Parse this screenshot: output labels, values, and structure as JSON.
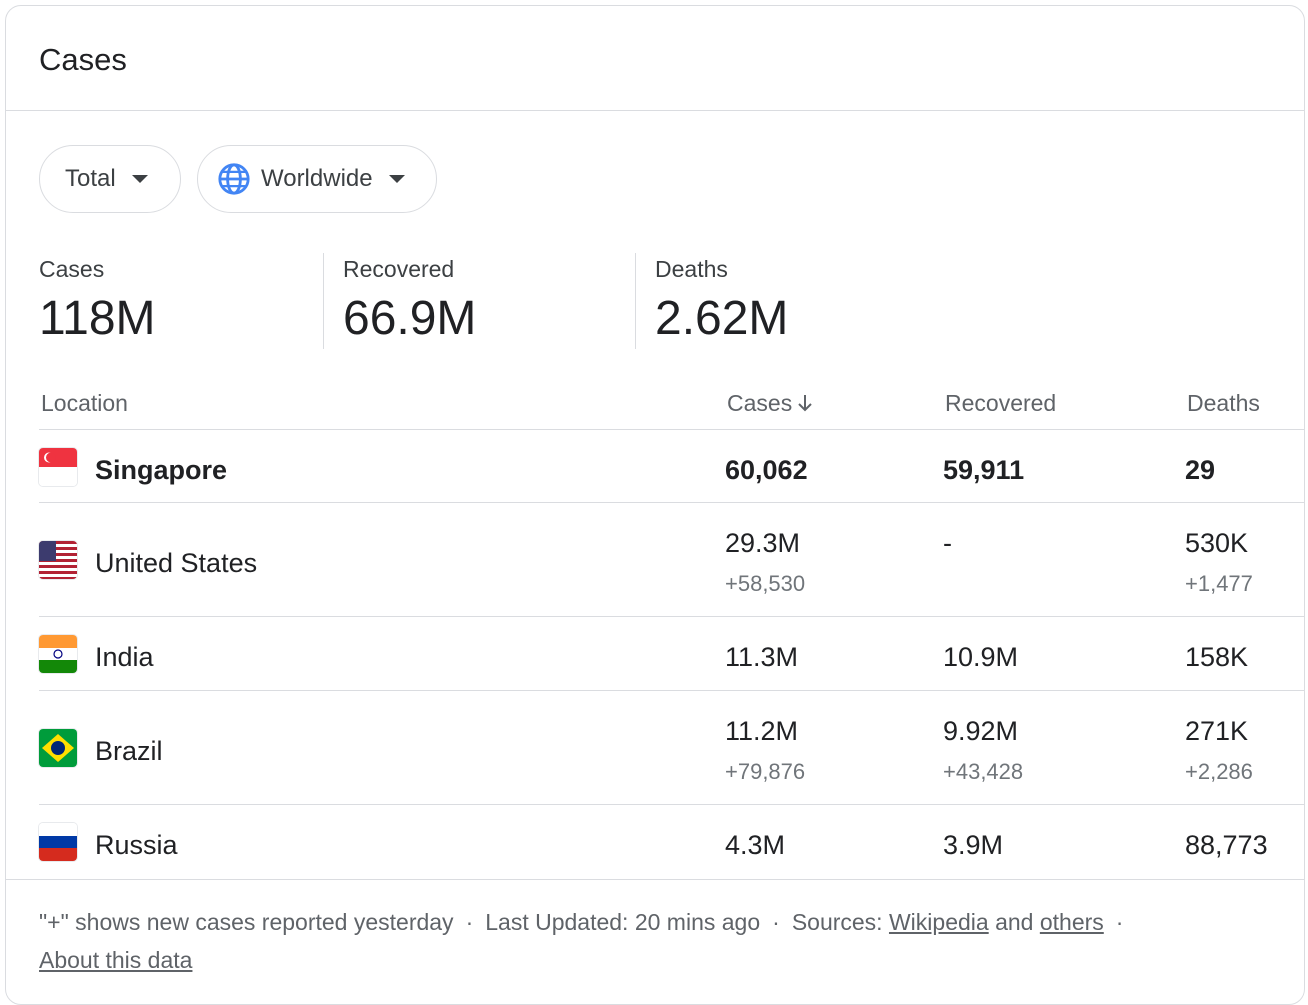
{
  "title": "Cases",
  "filters": {
    "total_label": "Total",
    "region_label": "Worldwide"
  },
  "summary": {
    "cases_label": "Cases",
    "cases_value": "118M",
    "recovered_label": "Recovered",
    "recovered_value": "66.9M",
    "deaths_label": "Deaths",
    "deaths_value": "2.62M"
  },
  "table": {
    "headers": {
      "location": "Location",
      "cases": "Cases",
      "recovered": "Recovered",
      "deaths": "Deaths"
    },
    "rows": [
      {
        "location": "Singapore",
        "cases": "60,062",
        "cases_new": "",
        "recovered": "59,911",
        "recovered_new": "",
        "deaths": "29",
        "deaths_new": "",
        "flag": "singapore-flag-icon"
      },
      {
        "location": "United States",
        "cases": "29.3M",
        "cases_new": "+58,530",
        "recovered": "-",
        "recovered_new": "",
        "deaths": "530K",
        "deaths_new": "+1,477",
        "flag": "united-states-flag-icon"
      },
      {
        "location": "India",
        "cases": "11.3M",
        "cases_new": "",
        "recovered": "10.9M",
        "recovered_new": "",
        "deaths": "158K",
        "deaths_new": "",
        "flag": "india-flag-icon"
      },
      {
        "location": "Brazil",
        "cases": "11.2M",
        "cases_new": "+79,876",
        "recovered": "9.92M",
        "recovered_new": "+43,428",
        "deaths": "271K",
        "deaths_new": "+2,286",
        "flag": "brazil-flag-icon"
      },
      {
        "location": "Russia",
        "cases": "4.3M",
        "cases_new": "",
        "recovered": "3.9M",
        "recovered_new": "",
        "deaths": "88,773",
        "deaths_new": "",
        "flag": "russia-flag-icon"
      }
    ]
  },
  "footer": {
    "note": "\"+\" shows new cases reported yesterday",
    "separator": "·",
    "updated": "Last Updated: 20 mins ago",
    "sources_label": "Sources:",
    "source_link_1": "Wikipedia",
    "and_text": "and",
    "source_link_2": "others",
    "about_link": "About this data"
  },
  "colors": {
    "text": "#202124",
    "muted": "#5f6368",
    "divider": "#dadce0",
    "globe_blue": "#4285f4"
  }
}
